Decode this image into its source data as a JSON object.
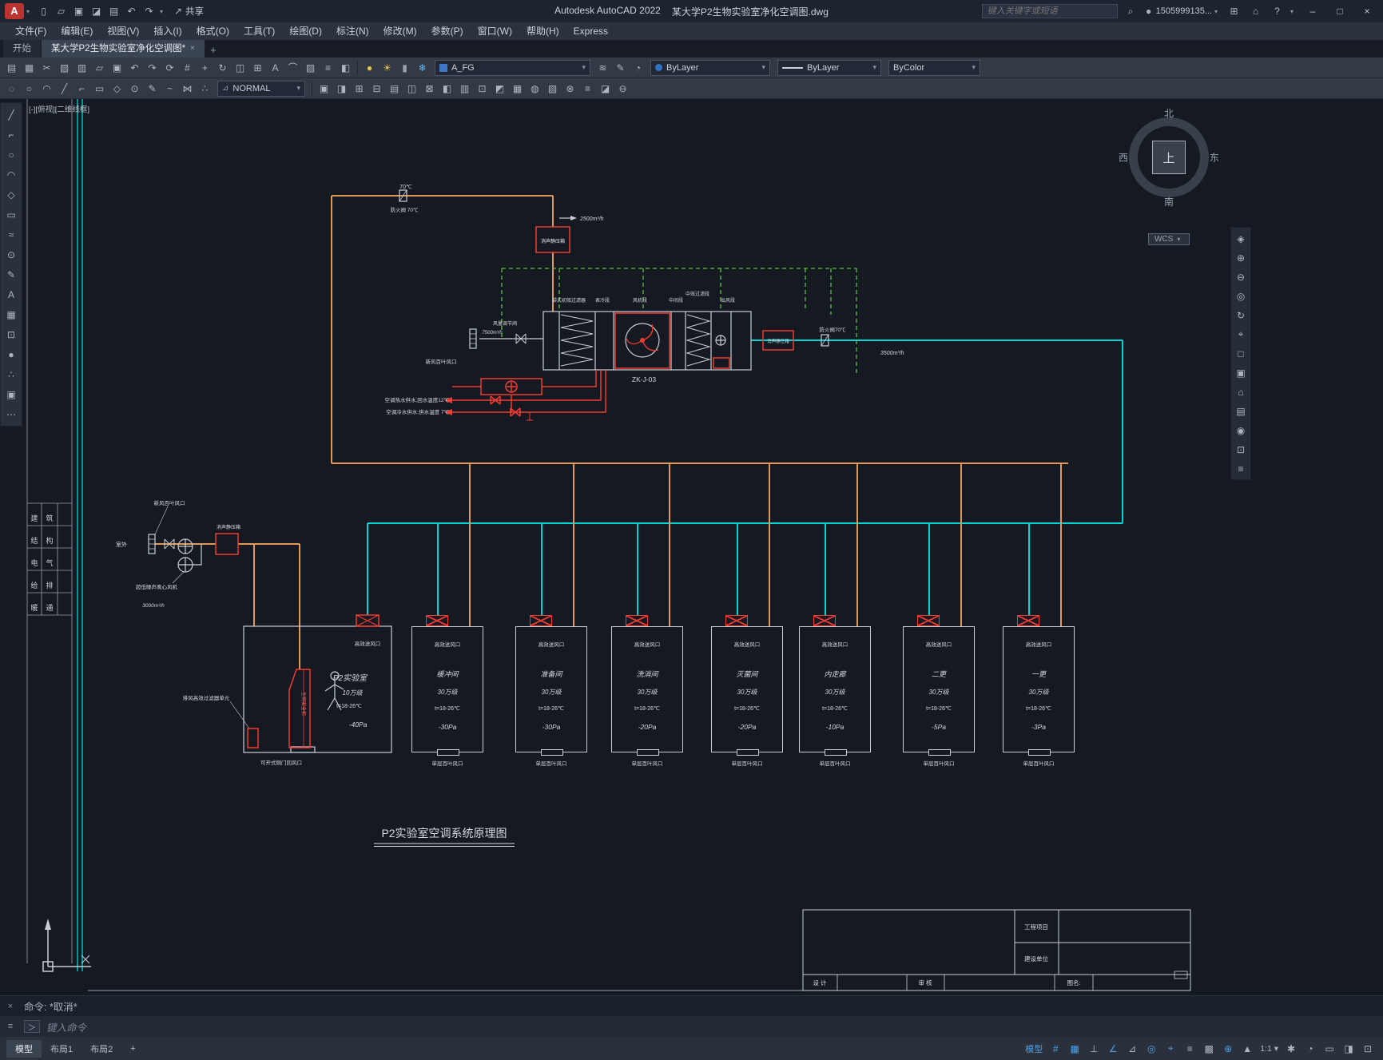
{
  "titlebar": {
    "logo": "A",
    "qat_icons": [
      {
        "name": "new-icon",
        "glyph": "▯"
      },
      {
        "name": "open-icon",
        "glyph": "▱"
      },
      {
        "name": "save-icon",
        "glyph": "▣"
      },
      {
        "name": "save-as-icon",
        "glyph": "◪"
      },
      {
        "name": "plot-icon",
        "glyph": "▤"
      },
      {
        "name": "undo-icon",
        "glyph": "↶"
      },
      {
        "name": "redo-icon",
        "glyph": "↷"
      }
    ],
    "share_label": "共享",
    "app_title": "Autodesk AutoCAD 2022",
    "doc_title": "某大学P2生物实验室净化空调图.dwg",
    "search_placeholder": "键入关键字或短语",
    "user": "1505999135...",
    "help_label": "?",
    "win_min": "–",
    "win_max": "□",
    "win_close": "×"
  },
  "menubar": {
    "items": [
      "文件(F)",
      "编辑(E)",
      "视图(V)",
      "插入(I)",
      "格式(O)",
      "工具(T)",
      "绘图(D)",
      "标注(N)",
      "修改(M)",
      "参数(P)",
      "窗口(W)",
      "帮助(H)",
      "Express"
    ]
  },
  "tabs": {
    "start": "开始",
    "doc": "某大学P2生物实验室净化空调图*",
    "close": "×",
    "add": "+"
  },
  "ribbon": {
    "row1_icons": [
      {
        "name": "paste-icon",
        "glyph": "▤"
      },
      {
        "name": "copy-icon",
        "glyph": "▦"
      },
      {
        "name": "cut-icon",
        "glyph": "✂"
      },
      {
        "name": "match-properties-icon",
        "glyph": "▧"
      },
      {
        "name": "print-icon",
        "glyph": "▥"
      },
      {
        "name": "open-icon",
        "glyph": "▱"
      },
      {
        "name": "save-icon",
        "glyph": "▣"
      },
      {
        "name": "undo-icon",
        "glyph": "↶"
      },
      {
        "name": "redo-icon",
        "glyph": "↷"
      },
      {
        "name": "regen-icon",
        "glyph": "⟳"
      },
      {
        "name": "grid-icon",
        "glyph": "#"
      },
      {
        "name": "move-icon",
        "glyph": "+"
      },
      {
        "name": "rotate-icon",
        "glyph": "↻"
      },
      {
        "name": "mirror-icon",
        "glyph": "◫"
      },
      {
        "name": "array-icon",
        "glyph": "⊞"
      },
      {
        "name": "text-icon",
        "glyph": "A"
      },
      {
        "name": "arc-icon",
        "glyph": "⌒"
      },
      {
        "name": "hatch-icon",
        "glyph": "▨"
      },
      {
        "name": "layer-list-icon",
        "glyph": "≡"
      },
      {
        "name": "properties-icon",
        "glyph": "◧"
      }
    ],
    "layer_state_icons": [
      {
        "name": "layer-on-bulb-icon",
        "glyph": "●",
        "style": "color:#e3c44a"
      },
      {
        "name": "layer-thaw-sun-icon",
        "glyph": "☀",
        "style": "color:#e3c44a"
      },
      {
        "name": "layer-lock-icon",
        "glyph": "▮",
        "style": "color:#9aa2ad"
      },
      {
        "name": "layer-freeze-icon",
        "glyph": "❄",
        "style": "color:#69b6e8"
      }
    ],
    "layer_combo": "A_FG",
    "mid_icons": [
      {
        "name": "match-layer-icon",
        "glyph": "≋"
      },
      {
        "name": "make-current-icon",
        "glyph": "✎"
      },
      {
        "name": "layer-prev-icon",
        "glyph": "◔"
      }
    ],
    "color_combo": "ByLayer",
    "linetype_combo": "ByLayer",
    "lineweight_combo": "ByColor",
    "row2_icons_a": [
      {
        "name": "point-icon",
        "glyph": "◌"
      },
      {
        "name": "circle-icon",
        "glyph": "○"
      },
      {
        "name": "arc-icon",
        "glyph": "◠"
      },
      {
        "name": "line-icon",
        "glyph": "╱"
      },
      {
        "name": "polyline-icon",
        "glyph": "⌐"
      },
      {
        "name": "rectangle-icon",
        "glyph": "▭"
      },
      {
        "name": "polygon-icon",
        "glyph": "◇"
      },
      {
        "name": "donut-icon",
        "glyph": "⊙"
      },
      {
        "name": "sketch-icon",
        "glyph": "✎"
      },
      {
        "name": "spline-icon",
        "glyph": "~"
      },
      {
        "name": "intersect-icon",
        "glyph": "⋈"
      },
      {
        "name": "divide-icon",
        "glyph": "∴"
      }
    ],
    "style_combo": "NORMAL",
    "row2_icons_b": [
      {
        "name": "block-icon",
        "glyph": "▣"
      },
      {
        "name": "insert-icon",
        "glyph": "◨"
      },
      {
        "name": "array-icon",
        "glyph": "⊞"
      },
      {
        "name": "subtract-icon",
        "glyph": "⊟"
      },
      {
        "name": "paste-icon",
        "glyph": "▤"
      },
      {
        "name": "mirror-icon",
        "glyph": "◫"
      },
      {
        "name": "explode-icon",
        "glyph": "⊠"
      },
      {
        "name": "trim-icon",
        "glyph": "◧"
      },
      {
        "name": "plot-icon",
        "glyph": "▥"
      },
      {
        "name": "region-icon",
        "glyph": "⊡"
      },
      {
        "name": "fillet-icon",
        "glyph": "◩"
      },
      {
        "name": "hatch-icon",
        "glyph": "▦"
      },
      {
        "name": "gradient-icon",
        "glyph": "◍"
      },
      {
        "name": "boundary-icon",
        "glyph": "▧"
      },
      {
        "name": "multiply-icon",
        "glyph": "⊗"
      },
      {
        "name": "stack-icon",
        "glyph": "≡"
      },
      {
        "name": "wipeout-icon",
        "glyph": "◪"
      },
      {
        "name": "offset-icon",
        "glyph": "⊖"
      }
    ]
  },
  "left_toolbar": [
    {
      "name": "line-icon",
      "glyph": "╱"
    },
    {
      "name": "polyline-icon",
      "glyph": "⌐"
    },
    {
      "name": "circle-icon",
      "glyph": "○"
    },
    {
      "name": "arc-icon",
      "glyph": "◠"
    },
    {
      "name": "polygon-icon",
      "glyph": "◇"
    },
    {
      "name": "rectangle-icon",
      "glyph": "▭"
    },
    {
      "name": "spline-icon",
      "glyph": "≈"
    },
    {
      "name": "ellipse-icon",
      "glyph": "⊙"
    },
    {
      "name": "edit-icon",
      "glyph": "✎"
    },
    {
      "name": "text-icon",
      "glyph": "A"
    },
    {
      "name": "table-icon",
      "glyph": "▦"
    },
    {
      "name": "region-icon",
      "glyph": "⊡"
    },
    {
      "name": "point-icon",
      "glyph": "●"
    },
    {
      "name": "divide-icon",
      "glyph": "∴"
    },
    {
      "name": "block-icon",
      "glyph": "▣"
    },
    {
      "name": "more-icon",
      "glyph": "⋯"
    }
  ],
  "right_navbar": [
    {
      "name": "steering-wheel-icon",
      "glyph": "◈"
    },
    {
      "name": "zoom-in-icon",
      "glyph": "⊕"
    },
    {
      "name": "zoom-out-icon",
      "glyph": "⊖"
    },
    {
      "name": "orbit-icon",
      "glyph": "◎"
    },
    {
      "name": "refresh-icon",
      "glyph": "↻"
    },
    {
      "name": "center-icon",
      "glyph": "⌖"
    },
    {
      "name": "extents-icon",
      "glyph": "□"
    },
    {
      "name": "window-icon",
      "glyph": "▣"
    },
    {
      "name": "home-icon",
      "glyph": "⌂"
    },
    {
      "name": "sheet-icon",
      "glyph": "▤"
    },
    {
      "name": "target-icon",
      "glyph": "◉"
    },
    {
      "name": "clean-icon",
      "glyph": "⊡"
    },
    {
      "name": "menu-icon",
      "glyph": "≡"
    }
  ],
  "canvas": {
    "viewport_label": "[-][俯视][二维线框]",
    "viewcube": {
      "north": "北",
      "south": "南",
      "west": "西",
      "east": "东",
      "top": "上",
      "wcs": "WCS"
    },
    "disciplines": [
      [
        "建",
        "筑"
      ],
      [
        "结",
        "构"
      ],
      [
        "电",
        "气"
      ],
      [
        "给",
        "排"
      ],
      [
        "暖",
        "通"
      ]
    ],
    "labels": {
      "t70": "70℃",
      "fire1": "防火阀 70℃",
      "flow2500": "2500m³/h",
      "muffler": "消声静压箱",
      "sec1": "袋式初效过滤器",
      "sec2": "表冷段",
      "sec3": "风机段",
      "sec4": "中间段",
      "sec5": "中效过滤段",
      "sec6": "出风段",
      "zk": "ZK-J-03",
      "damper": "风量调节阀",
      "flow7500": "7500m³/h",
      "fresh_louver": "新风百叶风口",
      "fire2": "防火阀70℃",
      "flow3500": "3500m³/h",
      "hot_water": "空调热水供水,回水温度12℃",
      "cold_water": "空调冷水供水,供水温度 7℃",
      "outdoor": "室外",
      "fan": "超低噪声离心风机",
      "flow3000": "3000m³/h",
      "supply_outlet": "高效送风口",
      "louver_outlet": "单层百叶风口",
      "title": "P2实验室空调系统原理图"
    },
    "room1": {
      "name": "P2实验室",
      "grade": "10万级",
      "temp": "t=18-26℃",
      "pa": "-40Pa",
      "exhaust_unit": "排风高效过滤器单元",
      "cabinet": "生物安全柜",
      "return_air": "可开式侧门回风口"
    },
    "rooms": [
      {
        "name": "缓冲间",
        "grade": "30万级",
        "temp": "t=18-26℃",
        "pa": "-30Pa",
        "style": "left:515px;width:90px"
      },
      {
        "name": "准备间",
        "grade": "30万级",
        "temp": "t=18-26℃",
        "pa": "-30Pa",
        "style": "left:645px;width:90px"
      },
      {
        "name": "洗消间",
        "grade": "30万级",
        "temp": "t=18-26℃",
        "pa": "-20Pa",
        "style": "left:765px;width:90px"
      },
      {
        "name": "灭菌间",
        "grade": "30万级",
        "temp": "t=18-26℃",
        "pa": "-20Pa",
        "style": "left:890px;width:90px"
      },
      {
        "name": "内走廊",
        "grade": "30万级",
        "temp": "t=18-26℃",
        "pa": "-10Pa",
        "style": "left:1000px;width:90px"
      },
      {
        "name": "二更",
        "grade": "30万级",
        "temp": "t=18-26℃",
        "pa": "-5Pa",
        "style": "left:1130px;width:90px"
      },
      {
        "name": "一更",
        "grade": "30万级",
        "temp": "t=18-26℃",
        "pa": "-3Pa",
        "style": "left:1255px;width:90px"
      }
    ],
    "titleblock": {
      "project": "工程项目",
      "owner": "建设单位",
      "design": "设 计",
      "review": "审 核",
      "fig": "图名:"
    }
  },
  "command": {
    "history": "命令: *取消*",
    "prompt": "键入命令",
    "close": "×",
    "tools": "≡",
    "caret": "＞"
  },
  "statusbar": {
    "tabs": [
      {
        "label": "模型"
      },
      {
        "label": "布局1"
      },
      {
        "label": "布局2"
      },
      {
        "label": "+"
      }
    ],
    "icons": [
      {
        "name": "model-space-toggle",
        "glyph": "模型",
        "style": "font-size:11px;color:#4aa0e8"
      },
      {
        "name": "grid-toggle",
        "glyph": "#",
        "style": "color:#4aa0e8"
      },
      {
        "name": "snap-toggle",
        "glyph": "▦",
        "style": "color:#4aa0e8"
      },
      {
        "name": "ortho-toggle",
        "glyph": "⊥"
      },
      {
        "name": "polar-toggle",
        "glyph": "∠",
        "style": "color:#4aa0e8"
      },
      {
        "name": "isodraft-toggle",
        "glyph": "⊿"
      },
      {
        "name": "osnap-toggle",
        "glyph": "◎",
        "style": "color:#4aa0e8"
      },
      {
        "name": "otrack-toggle",
        "glyph": "⌖",
        "style": "color:#4aa0e8"
      },
      {
        "name": "lineweight-toggle",
        "glyph": "≡"
      },
      {
        "name": "transparency-toggle",
        "glyph": "▩"
      },
      {
        "name": "dynamic-input-toggle",
        "glyph": "⊕",
        "style": "color:#4aa0e8"
      },
      {
        "name": "annotation-visibility",
        "glyph": "▲"
      },
      {
        "name": "annotation-scale",
        "glyph": "1:1 ▾",
        "style": "font-size:10.5px"
      },
      {
        "name": "workspace-switch",
        "glyph": "✱"
      },
      {
        "name": "annotation-monitor",
        "glyph": "◔"
      },
      {
        "name": "units-display",
        "glyph": "▭"
      },
      {
        "name": "quick-properties",
        "glyph": "◨"
      },
      {
        "name": "clean-screen",
        "glyph": "⊡"
      }
    ]
  }
}
